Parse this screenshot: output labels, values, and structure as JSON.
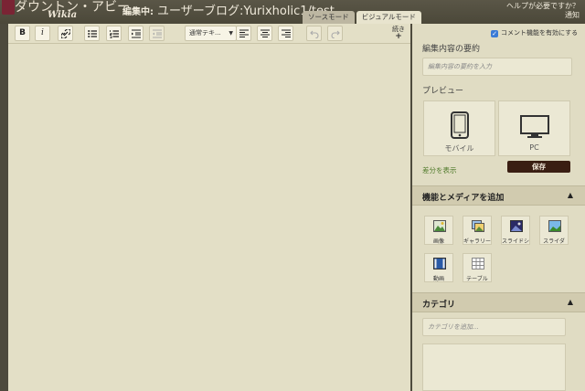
{
  "header": {
    "logo_text": "ダウントン・アビー",
    "logo_sub": "Wikia",
    "editing_label": "編集中:",
    "page_name": "ユーザーブログ:Yurixholic1/test",
    "help_text": "ヘルプが必要ですか？",
    "notify_text": "通知"
  },
  "mode_tabs": [
    {
      "label": "ソースモード",
      "active": false
    },
    {
      "label": "ビジュアルモード",
      "active": true
    }
  ],
  "toolbar": {
    "bold": "B",
    "italic": "i",
    "format_select": "通常テキ...",
    "more_label": "続き",
    "more_plus": "+"
  },
  "sidebar": {
    "comments_checkbox": "コメント機能を有効にする",
    "comments_checked": true,
    "summary_title": "編集内容の要約",
    "summary_placeholder": "編集内容の要約を入力",
    "preview_title": "プレビュー",
    "preview_mobile": "モバイル",
    "preview_pc": "PC",
    "diff_link": "差分を表示",
    "save_button": "保存",
    "media_header": "機能とメディアを追加",
    "media_tiles": [
      "画像",
      "ギャラリー",
      "スライドシ",
      "スライダ",
      "動画",
      "テーブル"
    ],
    "category_header": "カテゴリ",
    "category_placeholder": "カテゴリを追加..."
  },
  "colors": {
    "editor_bg": "#e3dfc6",
    "frame_bg": "#4d4a3d",
    "save_bg": "#3a1e12",
    "checkbox_accent": "#3b7bd6"
  }
}
